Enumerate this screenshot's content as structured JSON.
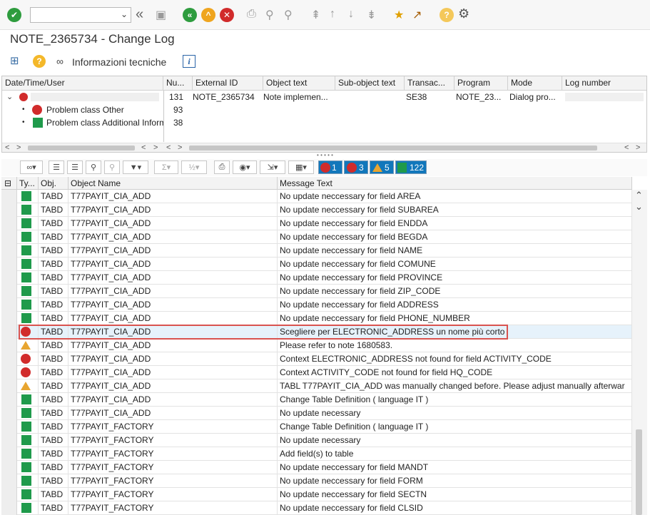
{
  "toolbar": {
    "command_field_value": "",
    "icons": [
      "check-icon",
      "back-icon",
      "save-icon",
      "back-green-icon",
      "exit-icon",
      "cancel-icon",
      "print-icon",
      "find-icon",
      "find-next-icon",
      "first-page-icon",
      "prev-page-icon",
      "next-page-icon",
      "last-page-icon",
      "new-session-icon",
      "shortcut-icon",
      "help-icon",
      "settings-icon"
    ]
  },
  "page": {
    "title": "NOTE_2365734 - Change Log"
  },
  "app_toolbar": {
    "tech_info_label": "Informazioni tecniche"
  },
  "tree": {
    "headers": [
      "Date/Time/User",
      "Nu...",
      "External ID",
      "Object text",
      "Sub-object text",
      "Transac...",
      "Program",
      "Mode",
      "Log number"
    ],
    "root": {
      "user": "",
      "number": "131",
      "external_id": "NOTE_2365734",
      "object_text": "Note implemen...",
      "sub_object_text": "",
      "transaction": "SE38",
      "program": "NOTE_23...",
      "mode": "Dialog pro...",
      "log_number": ""
    },
    "children": [
      {
        "label": "Problem class Other",
        "number": "93",
        "icon": "stop-icon"
      },
      {
        "label": "Problem class Additional Inform",
        "number": "38",
        "icon": "green-square-icon"
      }
    ]
  },
  "alv": {
    "counts": [
      {
        "value": "1",
        "icon": "stop-icon"
      },
      {
        "value": "3",
        "icon": "red-circle-icon"
      },
      {
        "value": "5",
        "icon": "warning-triangle-icon"
      },
      {
        "value": "122",
        "icon": "green-square-icon"
      }
    ]
  },
  "grid": {
    "headers": [
      "Ty...",
      "Obj.",
      "Object Name",
      "Message Text"
    ],
    "rows": [
      {
        "type": "ok",
        "obj": "TABD",
        "name": "T77PAYIT_CIA_ADD",
        "msg": "No update neccessary for field AREA"
      },
      {
        "type": "ok",
        "obj": "TABD",
        "name": "T77PAYIT_CIA_ADD",
        "msg": "No update neccessary for field SUBAREA"
      },
      {
        "type": "ok",
        "obj": "TABD",
        "name": "T77PAYIT_CIA_ADD",
        "msg": "No update neccessary for field ENDDA"
      },
      {
        "type": "ok",
        "obj": "TABD",
        "name": "T77PAYIT_CIA_ADD",
        "msg": "No update neccessary for field BEGDA"
      },
      {
        "type": "ok",
        "obj": "TABD",
        "name": "T77PAYIT_CIA_ADD",
        "msg": "No update neccessary for field NAME"
      },
      {
        "type": "ok",
        "obj": "TABD",
        "name": "T77PAYIT_CIA_ADD",
        "msg": "No update neccessary for field COMUNE"
      },
      {
        "type": "ok",
        "obj": "TABD",
        "name": "T77PAYIT_CIA_ADD",
        "msg": "No update neccessary for field PROVINCE"
      },
      {
        "type": "ok",
        "obj": "TABD",
        "name": "T77PAYIT_CIA_ADD",
        "msg": "No update neccessary for field ZIP_CODE"
      },
      {
        "type": "ok",
        "obj": "TABD",
        "name": "T77PAYIT_CIA_ADD",
        "msg": "No update neccessary for field ADDRESS"
      },
      {
        "type": "ok",
        "obj": "TABD",
        "name": "T77PAYIT_CIA_ADD",
        "msg": "No update neccessary for field PHONE_NUMBER"
      },
      {
        "type": "error",
        "obj": "TABD",
        "name": "T77PAYIT_CIA_ADD",
        "msg": "Scegliere per ELECTRONIC_ADDRESS un nome più corto"
      },
      {
        "type": "warning",
        "obj": "TABD",
        "name": "T77PAYIT_CIA_ADD",
        "msg": "Please refer to note 1680583."
      },
      {
        "type": "error",
        "obj": "TABD",
        "name": "T77PAYIT_CIA_ADD",
        "msg": "Context ELECTRONIC_ADDRESS not found for field ACTIVITY_CODE"
      },
      {
        "type": "error",
        "obj": "TABD",
        "name": "T77PAYIT_CIA_ADD",
        "msg": "Context ACTIVITY_CODE not found for field HQ_CODE"
      },
      {
        "type": "warning",
        "obj": "TABD",
        "name": "T77PAYIT_CIA_ADD",
        "msg": "TABL T77PAYIT_CIA_ADD was manually changed before. Please adjust manually afterwar"
      },
      {
        "type": "ok",
        "obj": "TABD",
        "name": "T77PAYIT_CIA_ADD",
        "msg": "Change Table Definition ( language IT )"
      },
      {
        "type": "ok",
        "obj": "TABD",
        "name": "T77PAYIT_CIA_ADD",
        "msg": "No update necessary"
      },
      {
        "type": "ok",
        "obj": "TABD",
        "name": "T77PAYIT_FACTORY",
        "msg": "Change Table Definition ( language IT )"
      },
      {
        "type": "ok",
        "obj": "TABD",
        "name": "T77PAYIT_FACTORY",
        "msg": "No update necessary"
      },
      {
        "type": "ok",
        "obj": "TABD",
        "name": "T77PAYIT_FACTORY",
        "msg": "Add field(s) to table"
      },
      {
        "type": "ok",
        "obj": "TABD",
        "name": "T77PAYIT_FACTORY",
        "msg": "No update neccessary for field MANDT"
      },
      {
        "type": "ok",
        "obj": "TABD",
        "name": "T77PAYIT_FACTORY",
        "msg": "No update neccessary for field FORM"
      },
      {
        "type": "ok",
        "obj": "TABD",
        "name": "T77PAYIT_FACTORY",
        "msg": "No update neccessary for field SECTN"
      },
      {
        "type": "ok",
        "obj": "TABD",
        "name": "T77PAYIT_FACTORY",
        "msg": "No update neccessary for field CLSID"
      }
    ]
  },
  "colors": {
    "ok": "#1f9a4b",
    "error": "#d12b2b",
    "warning": "#e8a530",
    "highlight": "#d9534f",
    "selection": "#e6f2fb"
  }
}
